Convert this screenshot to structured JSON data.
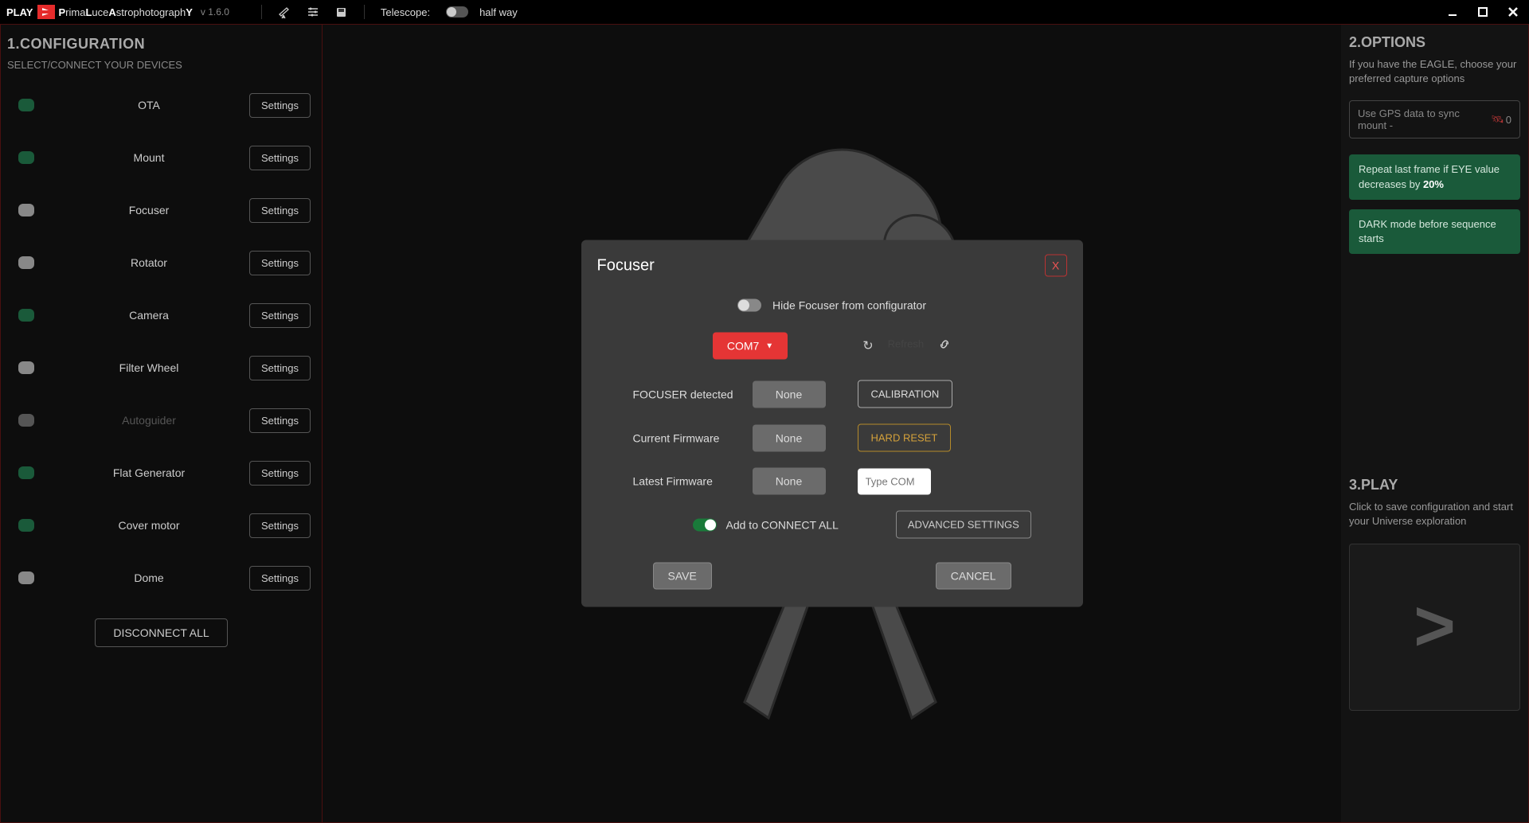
{
  "topbar": {
    "play": "PLAY",
    "brand_html": "PrimaLuceAstrophotographY",
    "version": "v 1.6.0",
    "telescope_label": "Telescope:",
    "halfway": "half way"
  },
  "left": {
    "title": "1.CONFIGURATION",
    "subtitle": "SELECT/CONNECT YOUR DEVICES",
    "settings_label": "Settings",
    "devices": [
      {
        "name": "OTA",
        "color": "#1a5a3a"
      },
      {
        "name": "Mount",
        "color": "#1a5a3a"
      },
      {
        "name": "Focuser",
        "color": "#888"
      },
      {
        "name": "Rotator",
        "color": "#888"
      },
      {
        "name": "Camera",
        "color": "#1a5a3a"
      },
      {
        "name": "Filter Wheel",
        "color": "#888"
      },
      {
        "name": "Autoguider",
        "color": "#555",
        "dim": true
      },
      {
        "name": "Flat Generator",
        "color": "#1a5a3a"
      },
      {
        "name": "Cover motor",
        "color": "#1a5a3a"
      },
      {
        "name": "Dome",
        "color": "#888"
      }
    ],
    "disconnect_all": "DISCONNECT ALL"
  },
  "modal": {
    "title": "Focuser",
    "close": "X",
    "hide_label": "Hide Focuser from configurator",
    "com_port": "COM7",
    "refresh_label": "Refresh",
    "rows": {
      "detected_label": "FOCUSER detected",
      "detected_value": "None",
      "calibration": "CALIBRATION",
      "current_fw_label": "Current Firmware",
      "current_fw_value": "None",
      "hard_reset": "HARD RESET",
      "latest_fw_label": "Latest Firmware",
      "latest_fw_value": "None",
      "com_placeholder": "Type COM"
    },
    "add_all": "Add to CONNECT ALL",
    "advanced": "ADVANCED SETTINGS",
    "save": "SAVE",
    "cancel": "CANCEL"
  },
  "right": {
    "options_title": "2.OPTIONS",
    "options_desc": "If you have the EAGLE, choose your preferred capture options",
    "gps_label": "Use GPS data to sync mount  -",
    "gps_count": "0",
    "repeat_prefix": "Repeat last frame if EYE value decreases by ",
    "repeat_pct": "20%",
    "dark_mode": "DARK mode before sequence starts",
    "play_title": "3.PLAY",
    "play_desc": "Click to save configuration and start your Universe exploration"
  }
}
